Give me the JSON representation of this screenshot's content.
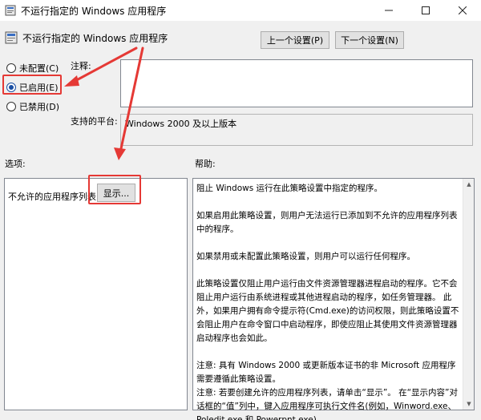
{
  "window": {
    "title": "不运行指定的 Windows 应用程序"
  },
  "header": {
    "title": "不运行指定的 Windows 应用程序"
  },
  "nav": {
    "prev_label": "上一个设置(P)",
    "next_label": "下一个设置(N)"
  },
  "state": {
    "options": [
      {
        "label": "未配置(C)",
        "selected": false
      },
      {
        "label": "已启用(E)",
        "selected": true
      },
      {
        "label": "已禁用(D)",
        "selected": false
      }
    ]
  },
  "comment": {
    "label": "注释:",
    "value": ""
  },
  "platform": {
    "label": "支持的平台:",
    "value": "Windows 2000 及以上版本"
  },
  "options_panel": {
    "label": "选项:",
    "item_label": "不允许的应用程序列表",
    "show_button": "显示..."
  },
  "help_panel": {
    "label": "帮助:",
    "paragraphs": [
      "阻止 Windows 运行在此策略设置中指定的程序。",
      "如果启用此策略设置，则用户无法运行已添加到不允许的应用程序列表中的程序。",
      "如果禁用或未配置此策略设置，则用户可以运行任何程序。",
      "此策略设置仅阻止用户运行由文件资源管理器进程启动的程序。它不会阻止用户运行由系统进程或其他进程启动的程序，如任务管理器。 此外，如果用户拥有命令提示符(Cmd.exe)的访问权限，则此策略设置不会阻止用户在命令窗口中启动程序，即使应阻止其使用文件资源管理器启动程序也会如此。",
      "注意: 具有 Windows 2000 或更新版本证书的非 Microsoft 应用程序需要遵循此策略设置。",
      "注意: 若要创建允许的应用程序列表，请单击“显示”。 在“显示内容”对话框的“值”列中，键入应用程序可执行文件名(例如，Winword.exe、Poledit.exe 和 Powerpnt.exe)。"
    ]
  },
  "annotation_color": "#e53935"
}
